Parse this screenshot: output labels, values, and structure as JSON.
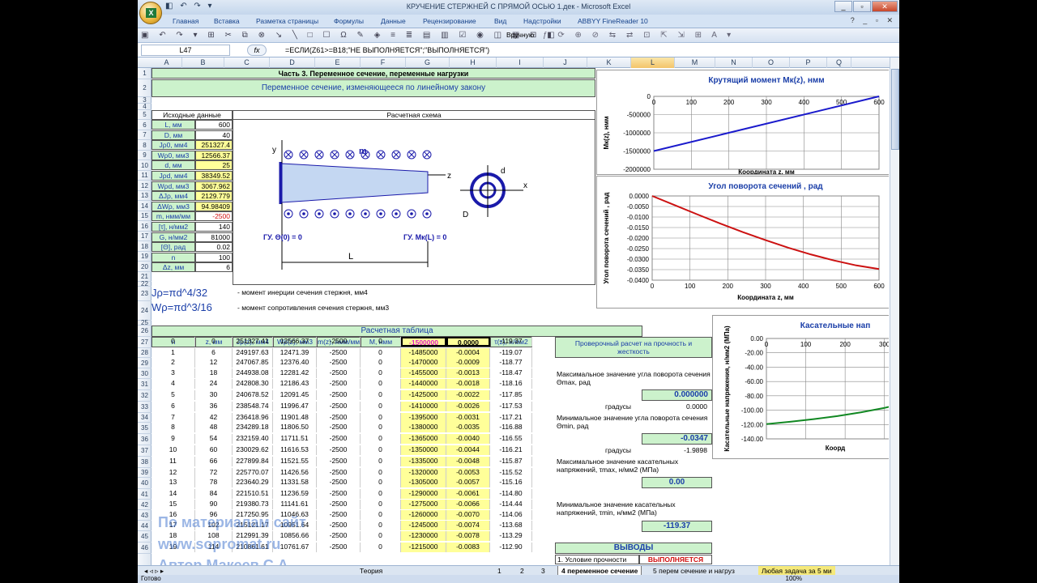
{
  "window": {
    "title": "КРУЧЕНИЕ СТЕРЖНЕЙ С ПРЯМОЙ ОСЬЮ 1.дек - Microsoft Excel",
    "controls": [
      "_",
      "▫",
      "✕"
    ]
  },
  "ribbon_tabs": [
    "Главная",
    "Вставка",
    "Разметка страницы",
    "Формулы",
    "Данные",
    "Рецензирование",
    "Вид",
    "Надстройки",
    "ABBYY FineReader 10"
  ],
  "toolbar": {
    "manual_label": "Вручную"
  },
  "formula_bar": {
    "cell": "L47",
    "fx": "fx",
    "formula": "=ЕСЛИ(Z61>=B18;\"НЕ ВЫПОЛНЯЕТСЯ\";\"ВЫПОЛНЯЕТСЯ\")"
  },
  "columns": [
    "A",
    "B",
    "C",
    "D",
    "E",
    "F",
    "G",
    "H",
    "I",
    "J",
    "K",
    "L",
    "M",
    "N",
    "O",
    "P",
    "Q"
  ],
  "rows": [
    "1",
    "2",
    "3",
    "4",
    "5",
    "6",
    "7",
    "8",
    "9",
    "10",
    "11",
    "12",
    "13",
    "14",
    "15",
    "16",
    "17",
    "18",
    "19",
    "20",
    "21",
    "22",
    "23",
    "24",
    "25",
    "26",
    "27",
    "28",
    "29",
    "30",
    "31",
    "32",
    "33",
    "34",
    "35",
    "36",
    "37",
    "38",
    "39",
    "40",
    "41",
    "42",
    "43",
    "44",
    "45",
    "46"
  ],
  "header": {
    "title": "Часть 3. Переменное сечение, переменные нагрузки",
    "subtitle": "Переменное сечение, изменяющееся по линейному закону"
  },
  "inputs": {
    "header": "Исходные данные",
    "items": [
      {
        "label": "L, мм",
        "value": "600"
      },
      {
        "label": "D, мм",
        "value": "40"
      },
      {
        "label": "Jρ0, мм4",
        "value": "251327.4"
      },
      {
        "label": "Wρ0, мм3",
        "value": "12566.37"
      },
      {
        "label": "d, мм",
        "value": "25"
      },
      {
        "label": "Jρd, мм4",
        "value": "38349.52"
      },
      {
        "label": "Wρd, мм3",
        "value": "3067.962"
      },
      {
        "label": "ΔJρ, мм4",
        "value": "2129.779"
      },
      {
        "label": "ΔWρ, мм3",
        "value": "94.98409"
      },
      {
        "label": "m, нмм/мм",
        "value": "-2500"
      },
      {
        "label": "[τ], н/мм2",
        "value": "140"
      },
      {
        "label": "G, н/мм2",
        "value": "81000"
      },
      {
        "label": "[Θ], рад",
        "value": "0.02"
      },
      {
        "label": "n",
        "value": "100"
      },
      {
        "label": "Δz, мм",
        "value": "6"
      }
    ]
  },
  "scheme": {
    "title": "Расчетная схема",
    "m": "m",
    "y": "y",
    "z": "z",
    "x": "x",
    "d": "d",
    "D": "D",
    "L": "L",
    "bc_left": "ГУ.  Θ(0) = 0",
    "bc_right": "ГУ.  Mк(L) = 0"
  },
  "formulas": [
    {
      "formula": "Jρ=πd^4/32",
      "desc": "- момент инерции сечения стержня, мм4"
    },
    {
      "formula": "Wρ=πd^3/16",
      "desc": "- момент сопротивления сечения стержня, мм3"
    }
  ],
  "table": {
    "title": "Расчетная таблица",
    "headers": [
      "n",
      "z, мм",
      "Jρ(z), мм4",
      "Wρ(z), мм3",
      "m(z), нмм/мм",
      "M, нмм",
      "Mк(z), нмм",
      "Θ(z), рад",
      "τ(z), н/мм2"
    ],
    "rows": [
      [
        "0",
        "0",
        "251327.41",
        "12566.37",
        "-2500",
        "0",
        "-1500000",
        "0.0000",
        "-119.37"
      ],
      [
        "1",
        "6",
        "249197.63",
        "12471.39",
        "-2500",
        "0",
        "-1485000",
        "-0.0004",
        "-119.07"
      ],
      [
        "2",
        "12",
        "247067.85",
        "12376.40",
        "-2500",
        "0",
        "-1470000",
        "-0.0009",
        "-118.77"
      ],
      [
        "3",
        "18",
        "244938.08",
        "12281.42",
        "-2500",
        "0",
        "-1455000",
        "-0.0013",
        "-118.47"
      ],
      [
        "4",
        "24",
        "242808.30",
        "12186.43",
        "-2500",
        "0",
        "-1440000",
        "-0.0018",
        "-118.16"
      ],
      [
        "5",
        "30",
        "240678.52",
        "12091.45",
        "-2500",
        "0",
        "-1425000",
        "-0.0022",
        "-117.85"
      ],
      [
        "6",
        "36",
        "238548.74",
        "11996.47",
        "-2500",
        "0",
        "-1410000",
        "-0.0026",
        "-117.53"
      ],
      [
        "7",
        "42",
        "236418.96",
        "11901.48",
        "-2500",
        "0",
        "-1395000",
        "-0.0031",
        "-117.21"
      ],
      [
        "8",
        "48",
        "234289.18",
        "11806.50",
        "-2500",
        "0",
        "-1380000",
        "-0.0035",
        "-116.88"
      ],
      [
        "9",
        "54",
        "232159.40",
        "11711.51",
        "-2500",
        "0",
        "-1365000",
        "-0.0040",
        "-116.55"
      ],
      [
        "10",
        "60",
        "230029.62",
        "11616.53",
        "-2500",
        "0",
        "-1350000",
        "-0.0044",
        "-116.21"
      ],
      [
        "11",
        "66",
        "227899.84",
        "11521.55",
        "-2500",
        "0",
        "-1335000",
        "-0.0048",
        "-115.87"
      ],
      [
        "12",
        "72",
        "225770.07",
        "11426.56",
        "-2500",
        "0",
        "-1320000",
        "-0.0053",
        "-115.52"
      ],
      [
        "13",
        "78",
        "223640.29",
        "11331.58",
        "-2500",
        "0",
        "-1305000",
        "-0.0057",
        "-115.16"
      ],
      [
        "14",
        "84",
        "221510.51",
        "11236.59",
        "-2500",
        "0",
        "-1290000",
        "-0.0061",
        "-114.80"
      ],
      [
        "15",
        "90",
        "219380.73",
        "11141.61",
        "-2500",
        "0",
        "-1275000",
        "-0.0066",
        "-114.44"
      ],
      [
        "16",
        "96",
        "217250.95",
        "11046.63",
        "-2500",
        "0",
        "-1260000",
        "-0.0070",
        "-114.06"
      ],
      [
        "17",
        "102",
        "215121.17",
        "10951.64",
        "-2500",
        "0",
        "-1245000",
        "-0.0074",
        "-113.68"
      ],
      [
        "18",
        "108",
        "212991.39",
        "10856.66",
        "-2500",
        "0",
        "-1230000",
        "-0.0078",
        "-113.29"
      ],
      [
        "19",
        "114",
        "210861.61",
        "10761.67",
        "-2500",
        "0",
        "-1215000",
        "-0.0083",
        "-112.90"
      ]
    ]
  },
  "checks": {
    "title": "Проверочный расчет на прочность и жесткость",
    "theta_max_label": "Максимальное значение угла поворота сечения Θmax, рад",
    "theta_max": "0.000000",
    "degrees_label": "градусы",
    "theta_max_deg": "0.0000",
    "theta_min_label": "Минимальное значение угла поворота сечения Θmin, рад",
    "theta_min": "-0.0347",
    "theta_min_deg": "-1.9898",
    "tau_max_label": "Максимальное значение касательных напряжений, τmax, н/мм2 (МПа)",
    "tau_max": "0.00",
    "tau_min_label": "Минимальное значение касательных напряжений, τmin, н/мм2 (МПа)",
    "tau_min": "-119.37",
    "conclusions_title": "ВЫВОДЫ",
    "condition_label": "1. Условие прочности",
    "condition_value": "ВЫПОЛНЯЕТСЯ"
  },
  "chart_data": [
    {
      "type": "line",
      "title": "Крутящий момент Мк(z), нмм",
      "ylabel": "Мк(z), нмм",
      "xlabel": "Координата  z, мм",
      "x_ticks": [
        "0",
        "100",
        "200",
        "300",
        "400",
        "500",
        "600"
      ],
      "y_ticks": [
        "0",
        "-500000",
        "-1000000",
        "-1500000",
        "-2000000"
      ],
      "xlim": [
        0,
        600
      ],
      "ylim": [
        -2000000,
        0
      ],
      "grid": true,
      "color": "#1a1acc",
      "series": [
        {
          "x": [
            0,
            600
          ],
          "y": [
            -1500000,
            0
          ]
        }
      ]
    },
    {
      "type": "line",
      "title": "Угол поворота сечений , рад",
      "ylabel": "Угол поворота  сечений ,  рад",
      "xlabel": "Координата  z, мм",
      "x_ticks": [
        "0",
        "100",
        "200",
        "300",
        "400",
        "500",
        "600"
      ],
      "y_ticks": [
        "0.0000",
        "-0.0050",
        "-0.0100",
        "-0.0150",
        "-0.0200",
        "-0.0250",
        "-0.0300",
        "-0.0350",
        "-0.0400"
      ],
      "xlim": [
        0,
        600
      ],
      "ylim": [
        -0.04,
        0
      ],
      "grid": true,
      "color": "#cc1111",
      "series": [
        {
          "x": [
            0,
            60,
            120,
            180,
            240,
            300,
            360,
            420,
            480,
            540,
            600
          ],
          "y": [
            0,
            -0.0044,
            -0.0088,
            -0.0131,
            -0.0172,
            -0.021,
            -0.0246,
            -0.0278,
            -0.0306,
            -0.033,
            -0.0347
          ]
        }
      ]
    },
    {
      "type": "line",
      "title": "Касательные нап",
      "ylabel": "Касательные напряжения, н/мм2 (МПа)",
      "xlabel": "Коорд",
      "x_ticks": [
        "0",
        "100",
        "200",
        "300"
      ],
      "y_ticks": [
        "0.00",
        "-20.00",
        "-40.00",
        "-60.00",
        "-80.00",
        "-100.00",
        "-120.00",
        "-140.00"
      ],
      "xlim": [
        0,
        350
      ],
      "ylim": [
        -140,
        0
      ],
      "grid": true,
      "color": "#118822",
      "series": [
        {
          "x": [
            0,
            60,
            120,
            180,
            240,
            300,
            350
          ],
          "y": [
            -119.37,
            -116.21,
            -112.5,
            -108.2,
            -103.0,
            -96.8,
            -90.5
          ]
        }
      ]
    }
  ],
  "sheet_tabs": [
    "Теория",
    "1",
    "2",
    "3",
    "4 переменное сечение",
    "5 перем сечение и нагруз",
    "Любая задача за 5 ми"
  ],
  "watermark": [
    "По материалам сайт",
    "www.sopromat.ru",
    "Автор Макеев С.А."
  ],
  "status": "Готово",
  "zoom": "100%"
}
